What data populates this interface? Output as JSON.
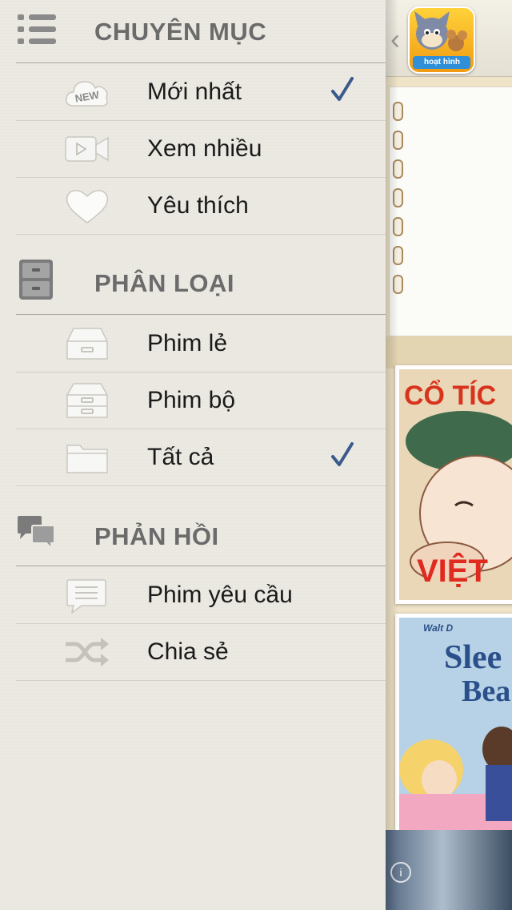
{
  "menu": {
    "sections": [
      {
        "title": "CHUYÊN MỤC",
        "icon": "list-icon",
        "items": [
          {
            "label": "Mới nhất",
            "icon": "new-badge-icon",
            "checked": true
          },
          {
            "label": "Xem nhiều",
            "icon": "video-camera-icon",
            "checked": false
          },
          {
            "label": "Yêu thích",
            "icon": "heart-icon",
            "checked": false
          }
        ]
      },
      {
        "title": "PHÂN LOẠI",
        "icon": "cabinet-icon",
        "items": [
          {
            "label": "Phim lẻ",
            "icon": "tray-icon",
            "checked": false
          },
          {
            "label": "Phim bộ",
            "icon": "drawer-icon",
            "checked": false
          },
          {
            "label": "Tất cả",
            "icon": "folder-icon",
            "checked": true
          }
        ]
      },
      {
        "title": "PHẢN HỒI",
        "icon": "chat-bubbles-icon",
        "items": [
          {
            "label": "Phim yêu cầu",
            "icon": "message-icon",
            "checked": false
          },
          {
            "label": "Chia sẻ",
            "icon": "shuffle-icon",
            "checked": false
          }
        ]
      }
    ]
  },
  "content": {
    "back_symbol": "‹",
    "logo_text": "hoạt hình",
    "poster1_top": "CỔ TÍC",
    "poster1_bottom": "VIỆT",
    "poster2_brand": "Walt D",
    "poster2_title_1": "Slee",
    "poster2_title_2": "Bea",
    "ad_info": "i"
  },
  "colors": {
    "check": "#3a5a8c",
    "section_title": "#6b6b6b",
    "menu_bg": "#ebe9e2"
  }
}
